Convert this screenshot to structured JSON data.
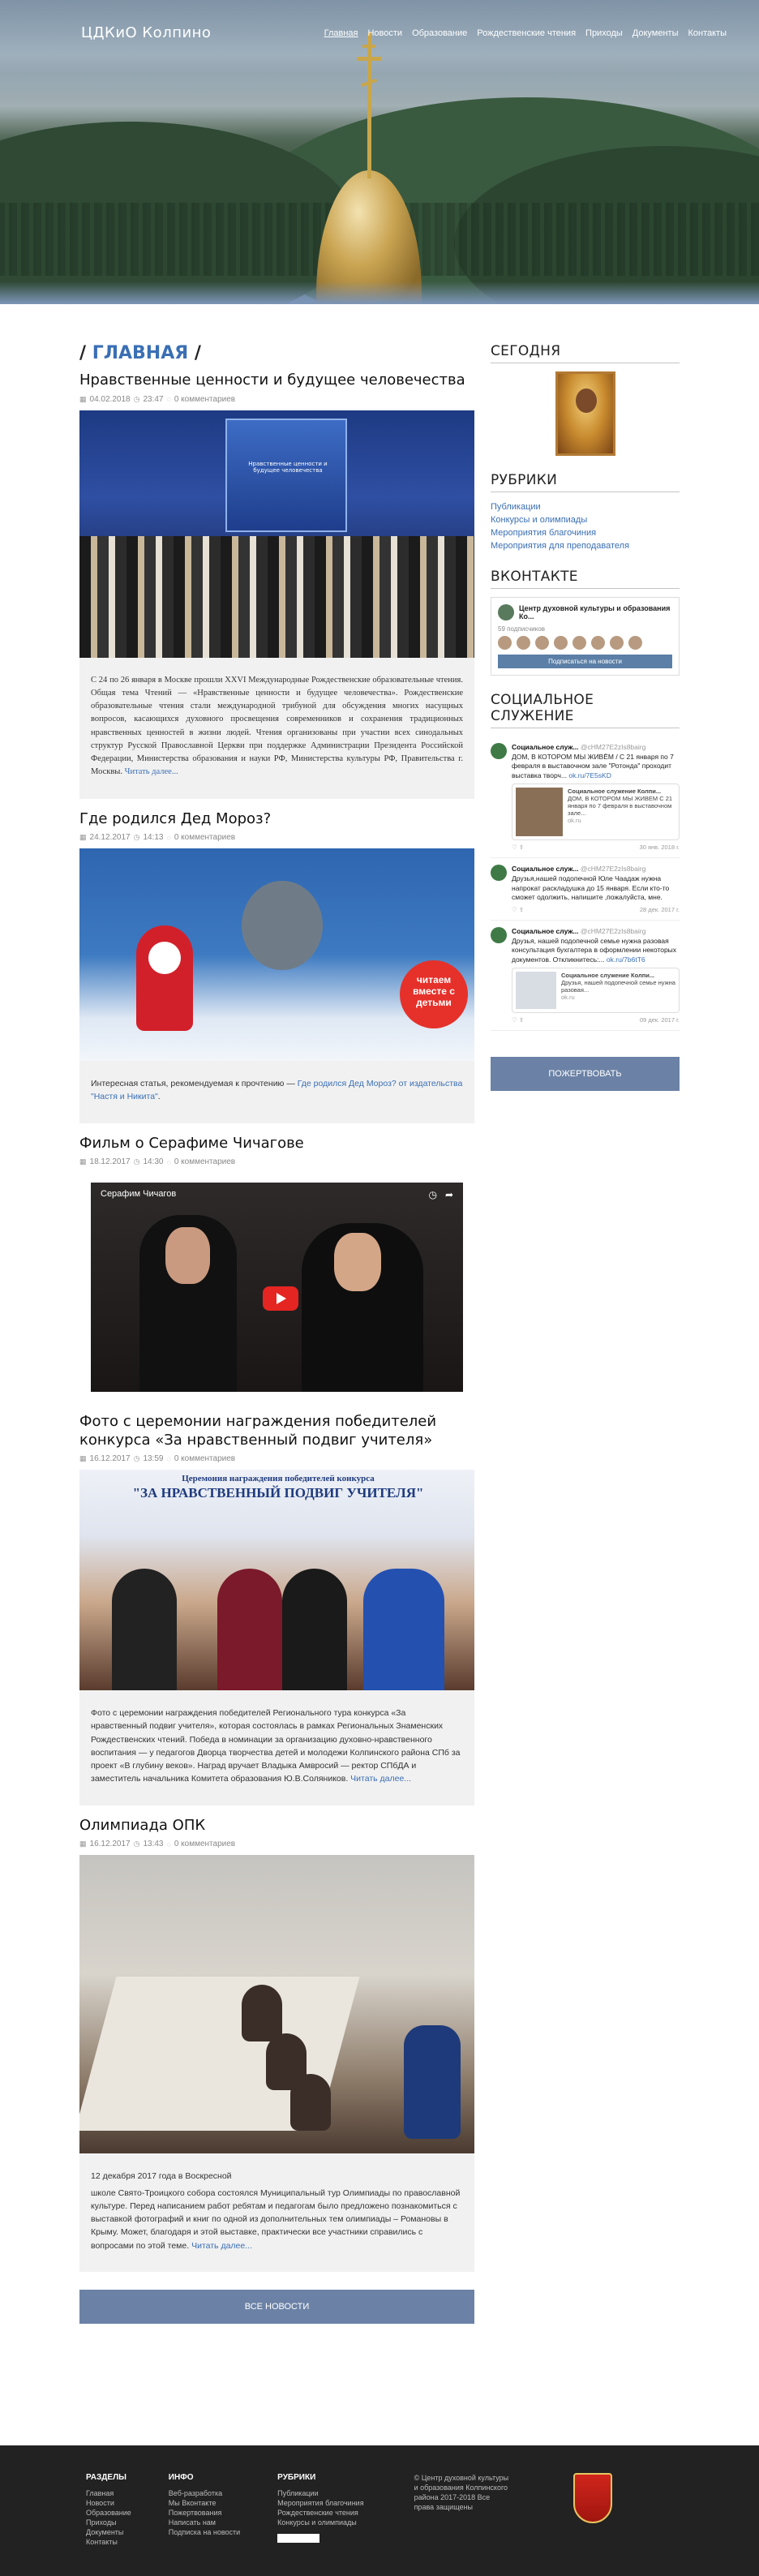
{
  "header": {
    "brand": "ЦДКиО Колпино",
    "nav": [
      "Главная",
      "Новости",
      "Образование",
      "Рождественские чтения",
      "Приходы",
      "Документы",
      "Контакты"
    ]
  },
  "breadcrumb": {
    "current": "ГЛАВНАЯ"
  },
  "posts": [
    {
      "title": "Нравственные ценности и будущее человечества",
      "date": "04.02.2018",
      "time": "23:47",
      "comments": "0 комментариев",
      "image_text": "Нравственные ценности и будущее человечества",
      "excerpt": "С 24 по 26 января в Москве прошли XXVI Международные Рождественские образовательные чтения. Общая тема Чтений — «Нравственные ценности и будущее человечества». Рождественские образовательные чтения стали международной трибуной для обсуждения многих насущных вопросов, касающихся духовного просвещения современников и сохранения традиционных нравственных ценностей в жизни людей. Чтения организованы при участии всех синодальных структур Русской Православной Церкви при поддержке Администрации Президента Российской Федерации, Министерства образования и науки РФ, Министерства культуры РФ, Правительства г. Москвы.",
      "more": "Читать далее..."
    },
    {
      "title": "Где родился Дед Мороз?",
      "date": "24.12.2017",
      "time": "14:13",
      "comments": "0 комментариев",
      "badge": "читаем вместе с детьми",
      "excerpt_pre": "Интересная статья, рекомендуемая к прочтению — ",
      "excerpt_link": "Где родился Дед Мороз? от издательства \"Настя и Никита\"",
      "excerpt_post": "."
    },
    {
      "title": "Фильм о Серафиме Чичагове",
      "date": "18.12.2017",
      "time": "14:30",
      "comments": "0 комментариев",
      "video_title": "Серафим Чичагов"
    },
    {
      "title": "Фото с церемонии награждения победителей конкурса «За нравственный подвиг учителя»",
      "date": "16.12.2017",
      "time": "13:59",
      "comments": "0 комментариев",
      "banner_top": "Церемония награждения победителей конкурса",
      "banner_main": "\"ЗА НРАВСТВЕННЫЙ ПОДВИГ УЧИТЕЛЯ\"",
      "excerpt": "Фото с церемонии награждения победителей Регионального тура конкурса «За нравственный подвиг учителя», которая состоялась в рамках Региональных Знаменских Рождественских чтений. Победа в номинации за организацию духовно-нравственного воспитания — у педагогов Дворца творчества детей и молодежи Колпинского района СПб за проект «В глубину веков». Наград вручает Владыка Амвросий — ректор СПбДА и заместитель начальника Комитета образования Ю.В.Соляников.",
      "more": "Читать далее..."
    },
    {
      "title": "Олимпиада ОПК",
      "date": "16.12.2017",
      "time": "13:43",
      "comments": "0 комментариев",
      "excerpt_head": "12 декабря 2017 года в Воскресной",
      "excerpt": "школе Свято-Троицкого собора состоялся Муниципальный тур Олимпиады по православной культуре. Перед написанием работ ребятам и педагогам было предложено познакомиться с выставкой фотографий и книг по одной из дополнительных тем олимпиады – Романовы в Крыму. Может, благодаря и этой выставке, практически все участники справились с вопросами по этой теме.",
      "more": "Читать далее..."
    }
  ],
  "all_news": "ВСЕ НОВОСТИ",
  "sidebar": {
    "today_title": "СЕГОДНЯ",
    "rubrics_title": "РУБРИКИ",
    "rubrics": [
      "Публикации",
      "Конкурсы и олимпиады",
      "Мероприятия благочиния",
      "Мероприятия для преподавателя"
    ],
    "vk_title": "ВКОНТАКТЕ",
    "vk": {
      "name": "Центр духовной культуры и образования Ко...",
      "count": "59 подписчиков",
      "subscribe": "Подписаться на новости"
    },
    "social_title": "СОЦИАЛЬНОЕ СЛУЖЕНИЕ",
    "tweets": [
      {
        "name": "Социальное служ...",
        "handle": "@cHM27E2zIs8bairg",
        "text": "ДОМ, В КОТОРОМ МЫ ЖИВЁМ / С 21 января по 7 февраля в выставочном зале \"Ротонда\" проходит выставка творч...",
        "link": "ok.ru/7E5sKD",
        "card_title": "Социальное служение Колпи...",
        "card_text": "ДОМ, В КОТОРОМ МЫ ЖИВЕМ С 21 января по 7 февраля в выставочном зале...",
        "card_src": "ok.ru",
        "date": "30 янв. 2018 г."
      },
      {
        "name": "Социальное служ...",
        "handle": "@cHM27E2zIs8bairg",
        "text": "Друзья,нашей подопечной Юле Чаадаж нужна напрокат раскладушка до 15 января. Если кто-то сможет одолжить, напишите ,пожалуйста, мне.",
        "date": "28 дек. 2017 г."
      },
      {
        "name": "Социальное служ...",
        "handle": "@cHM27E2zIs8bairg",
        "text": "Друзья, нашей подопечной семье нужна разовая консультация бухгалтера в оформлении некоторых документов. Откликнитесь:...",
        "link": "ok.ru/7b6tT6",
        "card_title": "Социальное служение Колпи...",
        "card_text": "Друзья, нашей подопечной семье нужна разовая...",
        "card_src": "ok.ru",
        "date": "09 дек. 2017 г."
      }
    ],
    "donate": "ПОЖЕРТВОВАТЬ"
  },
  "footer": {
    "cols": [
      {
        "title": "РАЗДЕЛЫ",
        "items": [
          "Главная",
          "Новости",
          "Образование",
          "Приходы",
          "Документы",
          "Контакты"
        ]
      },
      {
        "title": "ИНФО",
        "items": [
          "Веб-разработка",
          "Мы Вконтакте",
          "Пожертвования",
          "Написать нам",
          "Подписка на новости"
        ]
      },
      {
        "title": "РУБРИКИ",
        "items": [
          "Публикации",
          "Мероприятия благочиния",
          "Рождественские чтения",
          "Конкурсы и олимпиады"
        ]
      }
    ],
    "copyright": "© Центр духовной культуры и образования Колпинского района 2017-2018 Все права защищены"
  }
}
